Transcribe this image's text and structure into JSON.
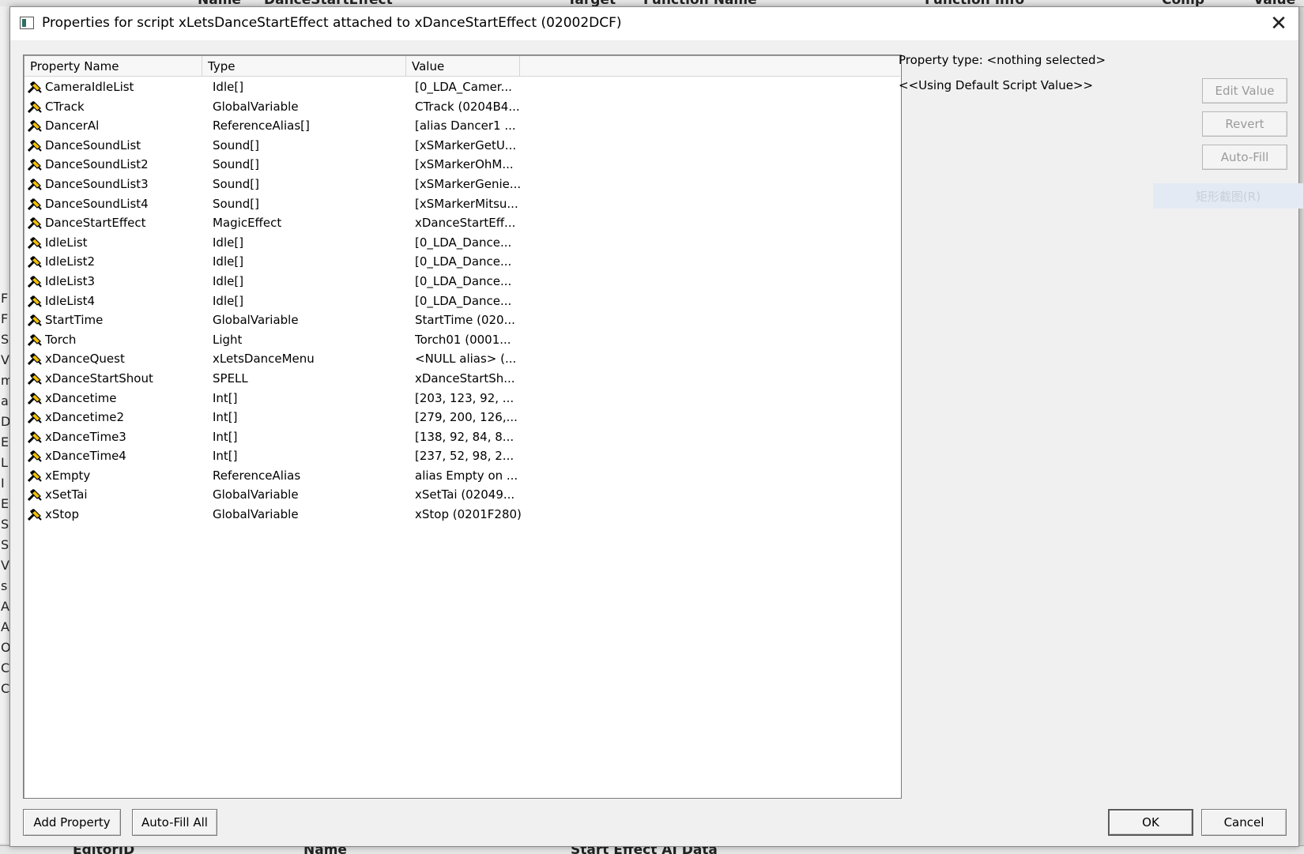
{
  "dialog": {
    "title": "Properties for script xLetsDanceStartEffect attached to xDanceStartEffect (02002DCF)",
    "close_glyph": "✕"
  },
  "columns": [
    "Property Name",
    "Type",
    "Value"
  ],
  "properties": [
    {
      "name": "CameraIdleList",
      "type": "Idle[]",
      "value": "[0_LDA_Camer..."
    },
    {
      "name": "CTrack",
      "type": "GlobalVariable",
      "value": "CTrack (0204B4..."
    },
    {
      "name": "DancerAl",
      "type": "ReferenceAlias[]",
      "value": "[alias Dancer1 ..."
    },
    {
      "name": "DanceSoundList",
      "type": "Sound[]",
      "value": "[xSMarkerGetU..."
    },
    {
      "name": "DanceSoundList2",
      "type": "Sound[]",
      "value": "[xSMarkerOhM..."
    },
    {
      "name": "DanceSoundList3",
      "type": "Sound[]",
      "value": "[xSMarkerGenie..."
    },
    {
      "name": "DanceSoundList4",
      "type": "Sound[]",
      "value": "[xSMarkerMitsu..."
    },
    {
      "name": "DanceStartEffect",
      "type": "MagicEffect",
      "value": "xDanceStartEff..."
    },
    {
      "name": "IdleList",
      "type": "Idle[]",
      "value": "[0_LDA_Dance..."
    },
    {
      "name": "IdleList2",
      "type": "Idle[]",
      "value": "[0_LDA_Dance..."
    },
    {
      "name": "IdleList3",
      "type": "Idle[]",
      "value": "[0_LDA_Dance..."
    },
    {
      "name": "IdleList4",
      "type": "Idle[]",
      "value": "[0_LDA_Dance..."
    },
    {
      "name": "StartTime",
      "type": "GlobalVariable",
      "value": "StartTime (020..."
    },
    {
      "name": "Torch",
      "type": "Light",
      "value": "Torch01 (0001..."
    },
    {
      "name": "xDanceQuest",
      "type": "xLetsDanceMenu",
      "value": "<NULL alias> (..."
    },
    {
      "name": "xDanceStartShout",
      "type": "SPELL",
      "value": "xDanceStartSh..."
    },
    {
      "name": "xDancetime",
      "type": "Int[]",
      "value": "[203, 123, 92, ..."
    },
    {
      "name": "xDancetime2",
      "type": "Int[]",
      "value": "[279, 200, 126,..."
    },
    {
      "name": "xDanceTime3",
      "type": "Int[]",
      "value": "[138, 92, 84, 8..."
    },
    {
      "name": "xDanceTime4",
      "type": "Int[]",
      "value": "[237, 52, 98, 2..."
    },
    {
      "name": "xEmpty",
      "type": "ReferenceAlias",
      "value": "alias Empty on ..."
    },
    {
      "name": "xSetTai",
      "type": "GlobalVariable",
      "value": "xSetTai (02049..."
    },
    {
      "name": "xStop",
      "type": "GlobalVariable",
      "value": "xStop (0201F280)"
    }
  ],
  "side_panel": {
    "property_type": "Property type: <nothing selected>",
    "default_value": "<<Using Default Script Value>>",
    "edit_value": "Edit Value",
    "revert": "Revert",
    "auto_fill": "Auto-Fill",
    "ghost_label": "矩形截图(R)"
  },
  "footer": {
    "add_property": "Add Property",
    "auto_fill_all": "Auto-Fill All",
    "ok": "OK",
    "cancel": "Cancel"
  },
  "background": {
    "top_labels": [
      "Name",
      "DanceStartEffect",
      "Target",
      "Function Name",
      "Function Info",
      "Comp",
      "Value"
    ],
    "left_letters": [
      "F",
      "F",
      "S",
      "V",
      "m",
      "a",
      "D",
      "E",
      "L",
      "I",
      "E",
      "S",
      "S",
      "V",
      "s",
      "A",
      "A",
      "O",
      "C",
      "C"
    ],
    "bottom_labels": [
      "EditorID",
      "Name",
      "Start Effect AI Data"
    ]
  },
  "colors": {
    "dialog_bg": "#f0f0f0",
    "list_bg": "#ffffff",
    "disabled_text": "#9a9a9a",
    "property_icon_yellow": "#f2c200"
  }
}
